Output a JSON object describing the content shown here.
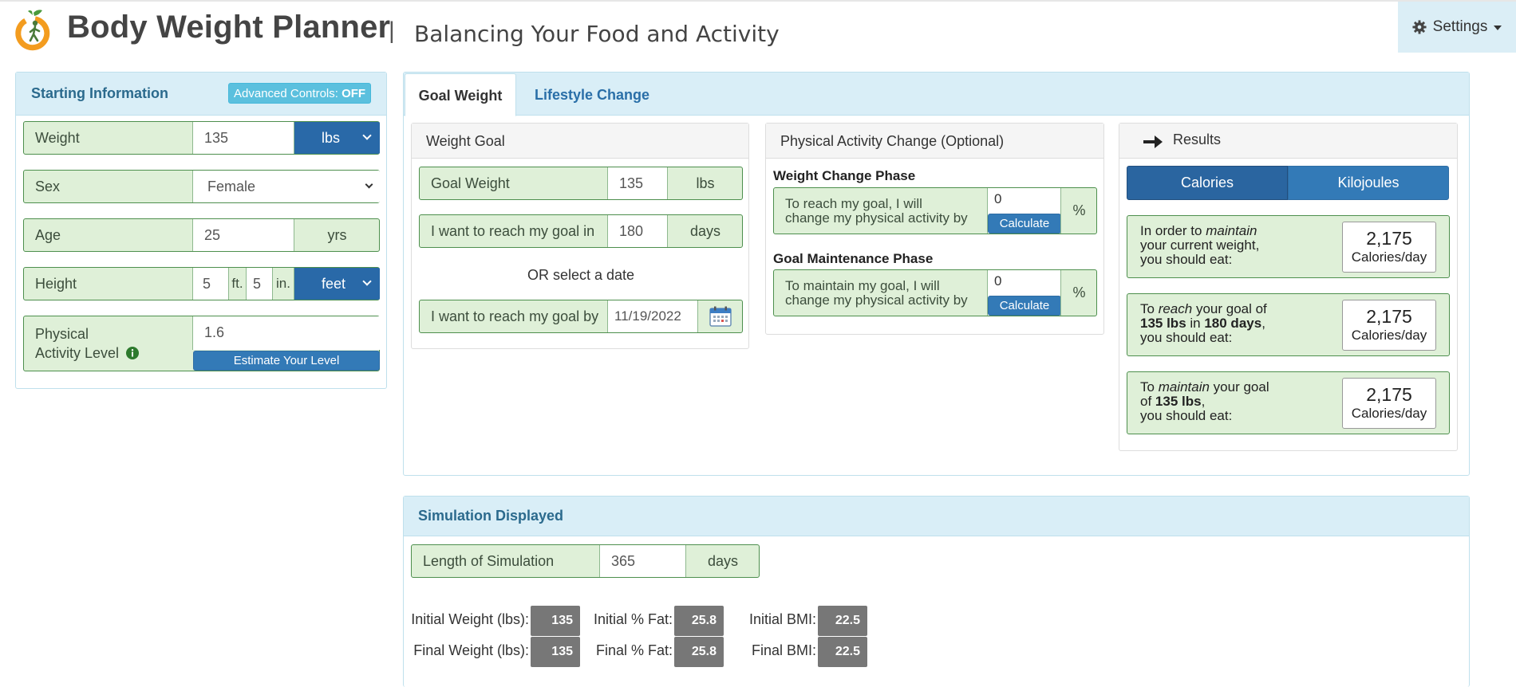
{
  "header": {
    "title": "Body Weight Planner",
    "separator": "|",
    "subtitle": "Balancing Your Food and Activity",
    "settings_label": "Settings"
  },
  "starting_info": {
    "title": "Starting Information",
    "advanced_label": "Advanced Controls:",
    "advanced_state": "OFF",
    "weight": {
      "label": "Weight",
      "value": "135",
      "unit": "lbs"
    },
    "sex": {
      "label": "Sex",
      "value": "Female"
    },
    "age": {
      "label": "Age",
      "value": "25",
      "unit": "yrs"
    },
    "height": {
      "label": "Height",
      "feet": "5",
      "feet_unit": "ft.",
      "inches": "5",
      "inches_unit": "in.",
      "unit": "feet"
    },
    "activity": {
      "label_line1": "Physical",
      "label_line2": "Activity Level",
      "value": "1.6",
      "estimate_button": "Estimate Your Level"
    }
  },
  "tabs": {
    "goal_weight": "Goal Weight",
    "lifestyle_change": "Lifestyle Change"
  },
  "weight_goal": {
    "title": "Weight Goal",
    "goal_weight": {
      "label": "Goal Weight",
      "value": "135",
      "unit": "lbs"
    },
    "reach_in": {
      "label": "I want to reach my goal in",
      "value": "180",
      "unit": "days"
    },
    "or_text": "OR select a date",
    "reach_by": {
      "label": "I want to reach my goal by",
      "value": "11/19/2022"
    }
  },
  "activity_change": {
    "title": "Physical Activity Change (Optional)",
    "change_phase": {
      "title": "Weight Change Phase",
      "line1": "To reach my goal, I will",
      "line2": "change my physical activity by",
      "value": "0",
      "button": "Calculate",
      "unit": "%"
    },
    "maintenance_phase": {
      "title": "Goal Maintenance Phase",
      "line1": "To maintain my goal, I will",
      "line2": "change my physical activity by",
      "value": "0",
      "button": "Calculate",
      "unit": "%"
    }
  },
  "results": {
    "title": "Results",
    "toggle_calories": "Calories",
    "toggle_kilojoules": "Kilojoules",
    "items": [
      {
        "t1": "In order to ",
        "em": "maintain",
        "t2": "your current weight,",
        "t3": "you should eat:",
        "value": "2,175",
        "unit": "Calories/day"
      },
      {
        "t1": "To ",
        "em": "reach",
        "t1b": " your goal of",
        "b1": "135 lbs",
        "mid": " in ",
        "b2": "180 days",
        "end": ",",
        "t3": "you should eat:",
        "value": "2,175",
        "unit": "Calories/day"
      },
      {
        "t1": "To ",
        "em": "maintain",
        "t1b": " your goal",
        "pre": "of ",
        "b1": "135 lbs",
        "end": ",",
        "t3": "you should eat:",
        "value": "2,175",
        "unit": "Calories/day"
      }
    ]
  },
  "simulation": {
    "title": "Simulation Displayed",
    "length": {
      "label": "Length of Simulation",
      "value": "365",
      "unit": "days"
    },
    "stats": {
      "initial_weight_label": "Initial Weight (lbs):",
      "initial_weight": "135",
      "initial_fat_label": "Initial % Fat:",
      "initial_fat": "25.8",
      "initial_bmi_label": "Initial BMI:",
      "initial_bmi": "22.5",
      "final_weight_label": "Final Weight (lbs):",
      "final_weight": "135",
      "final_fat_label": "Final % Fat:",
      "final_fat": "25.8",
      "final_bmi_label": "Final BMI:",
      "final_bmi": "22.5"
    }
  },
  "colors": {
    "accent_blue": "#337ab7",
    "panel_blue": "#d9eef7",
    "green_row": "#dff0d8",
    "logo_orange": "#f39c1f"
  },
  "icons": [
    "app-logo-icon",
    "gear-icon",
    "info-icon",
    "calendar-icon",
    "arrow-right-icon"
  ]
}
